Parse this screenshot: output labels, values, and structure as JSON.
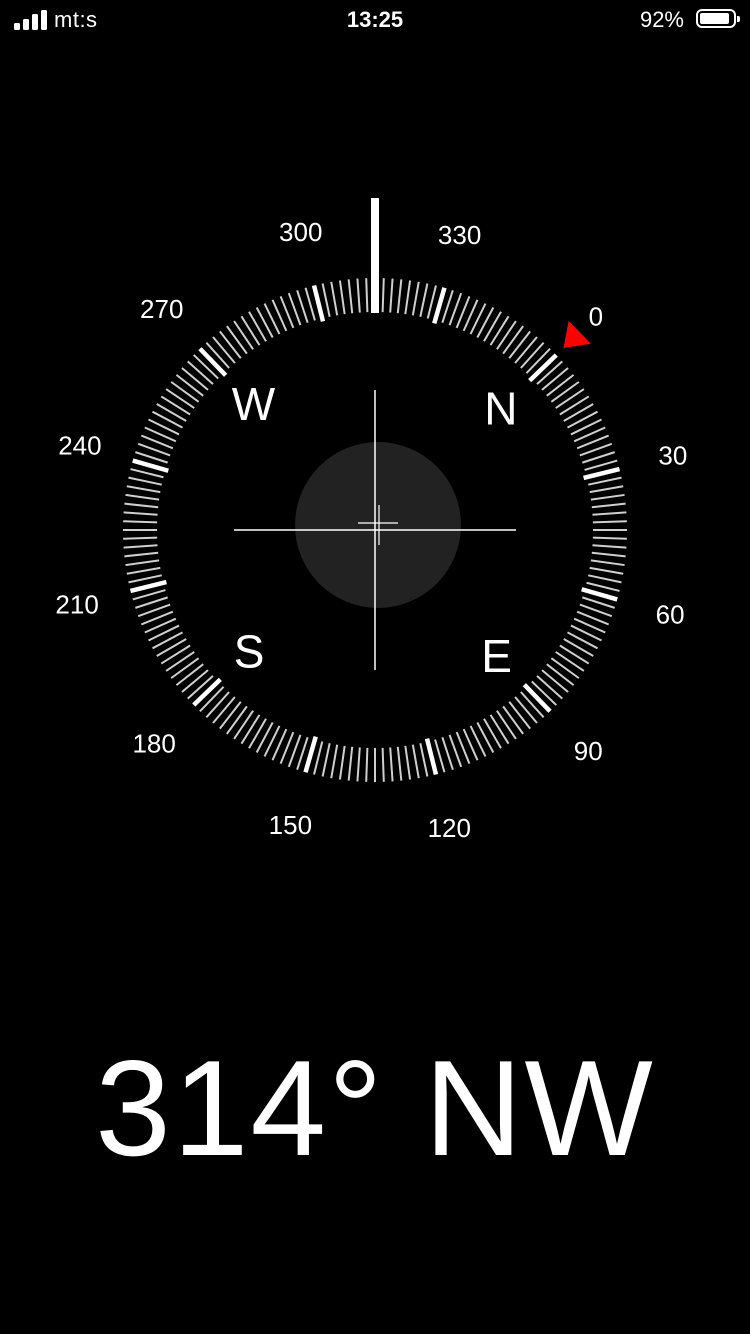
{
  "status_bar": {
    "carrier": "mt:s",
    "time": "13:25",
    "battery_percent": "92%",
    "battery_level": 0.92,
    "signal_bars": 4
  },
  "compass": {
    "heading_degrees": 314,
    "cardinals": [
      "N",
      "E",
      "S",
      "W"
    ],
    "degree_labels": [
      "0",
      "30",
      "60",
      "90",
      "120",
      "150",
      "180",
      "210",
      "240",
      "270",
      "300",
      "330"
    ],
    "target_marker_color": "#ff0000",
    "center_disc_color": "#222222"
  },
  "readout": {
    "heading": "314° NW"
  }
}
